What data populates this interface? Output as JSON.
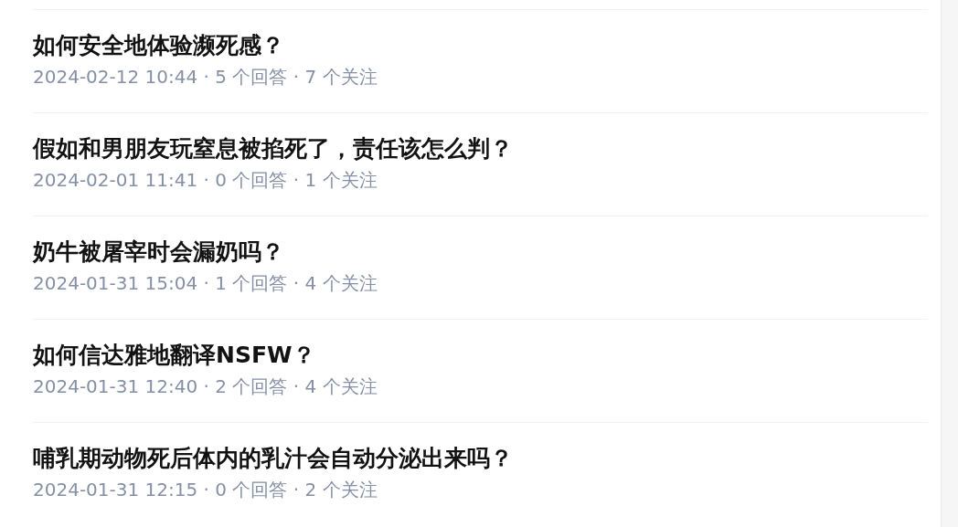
{
  "questions": [
    {
      "title": "如何安全地体验濒死感？",
      "meta": "2024-02-12 10:44 · 5 个回答 · 7 个关注"
    },
    {
      "title": "假如和男朋友玩窒息被掐死了，责任该怎么判？",
      "meta": "2024-02-01 11:41 · 0 个回答 · 1 个关注"
    },
    {
      "title": "奶牛被屠宰时会漏奶吗？",
      "meta": "2024-01-31 15:04 · 1 个回答 · 4 个关注"
    },
    {
      "title": "如何信达雅地翻译NSFW？",
      "meta": "2024-01-31 12:40 · 2 个回答 · 4 个关注"
    },
    {
      "title": "哺乳期动物死后体内的乳汁会自动分泌出来吗？",
      "meta": "2024-01-31 12:15 · 0 个回答 · 2 个关注"
    }
  ]
}
